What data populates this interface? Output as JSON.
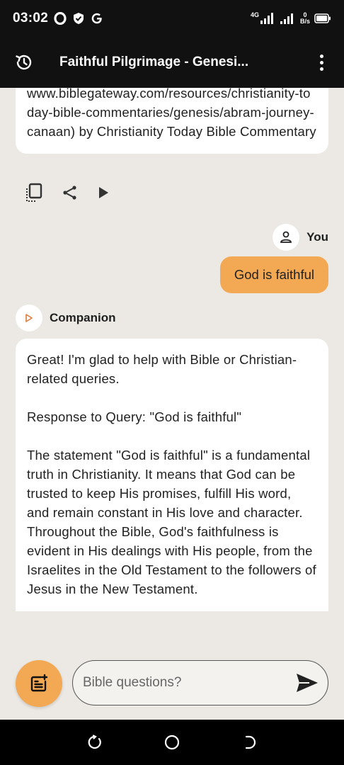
{
  "status_bar": {
    "time": "03:02",
    "left_icons": [
      "opera-icon",
      "shield-check-icon",
      "google-icon"
    ],
    "network_type": "4G",
    "net_speed_value": "0",
    "net_speed_unit": "B/s"
  },
  "app_bar": {
    "title": "Faithful Pilgrimage - Genesi..."
  },
  "messages": {
    "prev_ai_text": "www.biblegateway.com/resources/christianity-today-bible-commentaries/genesis/abram-journey-canaan) by Christianity Today Bible Commentary",
    "user_label": "You",
    "user_text": "God is faithful",
    "companion_label": "Companion",
    "ai_paragraphs": [
      "Great! I'm glad to help with Bible or Christian-related queries.",
      "Response to Query: \"God is faithful\"",
      "The statement \"God is faithful\" is a fundamental truth in Christianity. It means that God can be trusted to keep His promises, fulfill His word, and remain constant in His love and character. Throughout the Bible, God's faithfulness is evident in His dealings with His people, from the Israelites in the Old Testament to the followers of Jesus in the New Testament."
    ]
  },
  "composer": {
    "placeholder": "Bible questions?"
  },
  "colors": {
    "accent": "#f3a953",
    "background": "#ece9e4",
    "bar": "#111111"
  }
}
